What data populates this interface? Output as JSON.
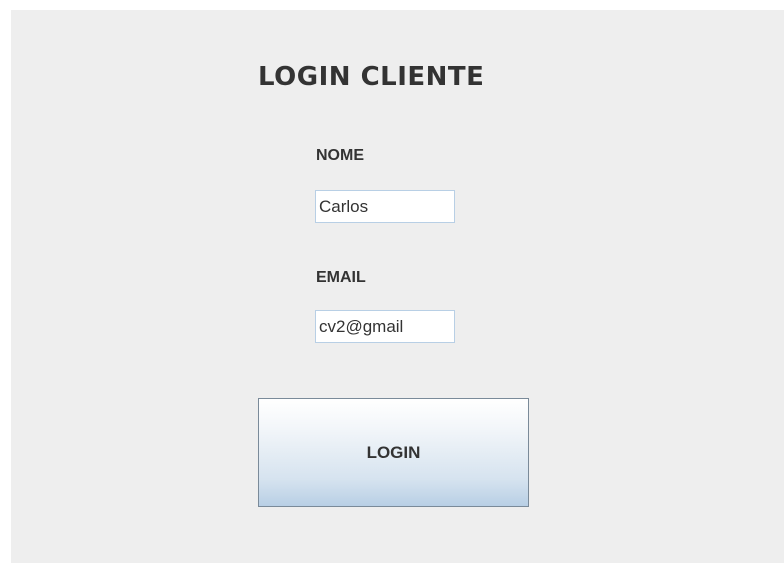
{
  "form": {
    "title": "LOGIN CLIENTE",
    "nome_label": "NOME",
    "nome_value": "Carlos",
    "email_label": "EMAIL",
    "email_value": "cv2@gmail",
    "login_button_label": "LOGIN"
  },
  "colors": {
    "background": "#eeeeee",
    "field_border": "#b8cfe5",
    "button_gradient_end": "#b8cfe5",
    "text": "#333333"
  }
}
